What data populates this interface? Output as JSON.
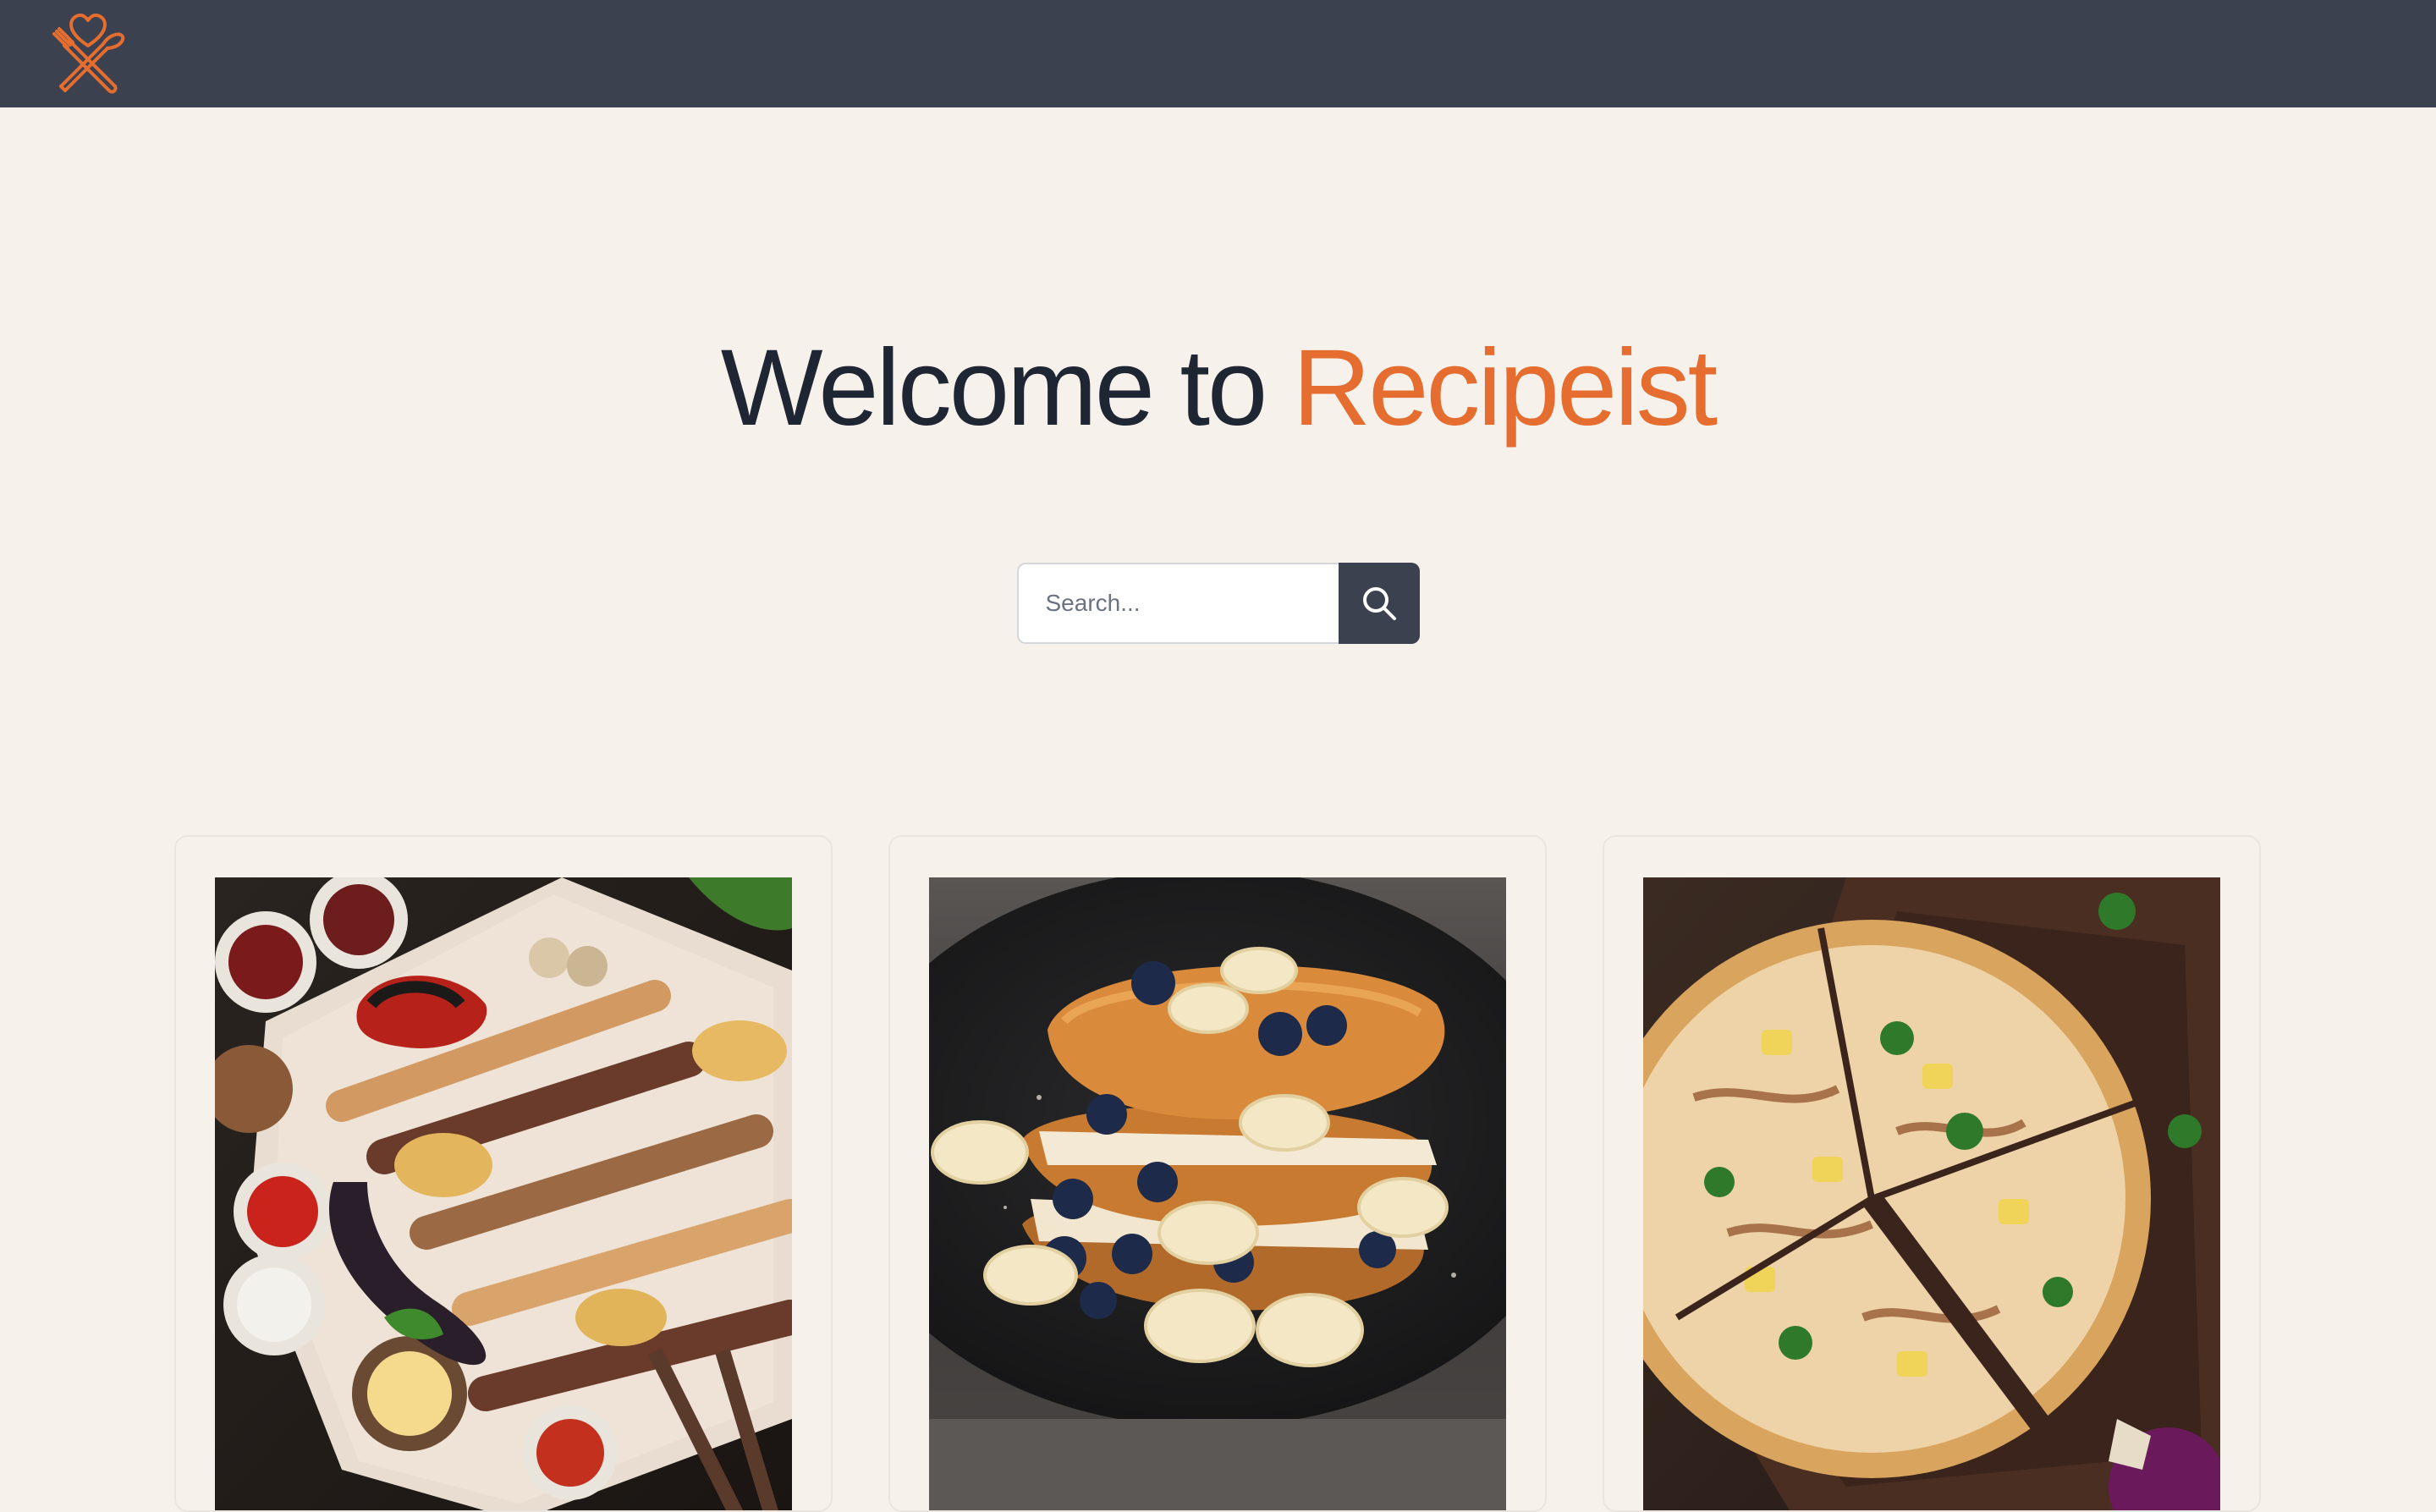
{
  "header": {
    "logo_icon": "heart-fork-knife-logo-icon",
    "accent_color": "#e46d2f"
  },
  "hero": {
    "title_prefix": "Welcome to ",
    "title_brand": "Recipeist"
  },
  "search": {
    "placeholder": "Search...",
    "button_icon": "search-icon"
  },
  "recipes": [
    {
      "image_icon": "grilled-skewers-image"
    },
    {
      "image_icon": "french-toast-image"
    },
    {
      "image_icon": "pizza-image"
    }
  ],
  "colors": {
    "navbar": "#3c4150",
    "background": "#f7f1ec",
    "brand": "#e46d2f",
    "text": "#1f2633"
  }
}
